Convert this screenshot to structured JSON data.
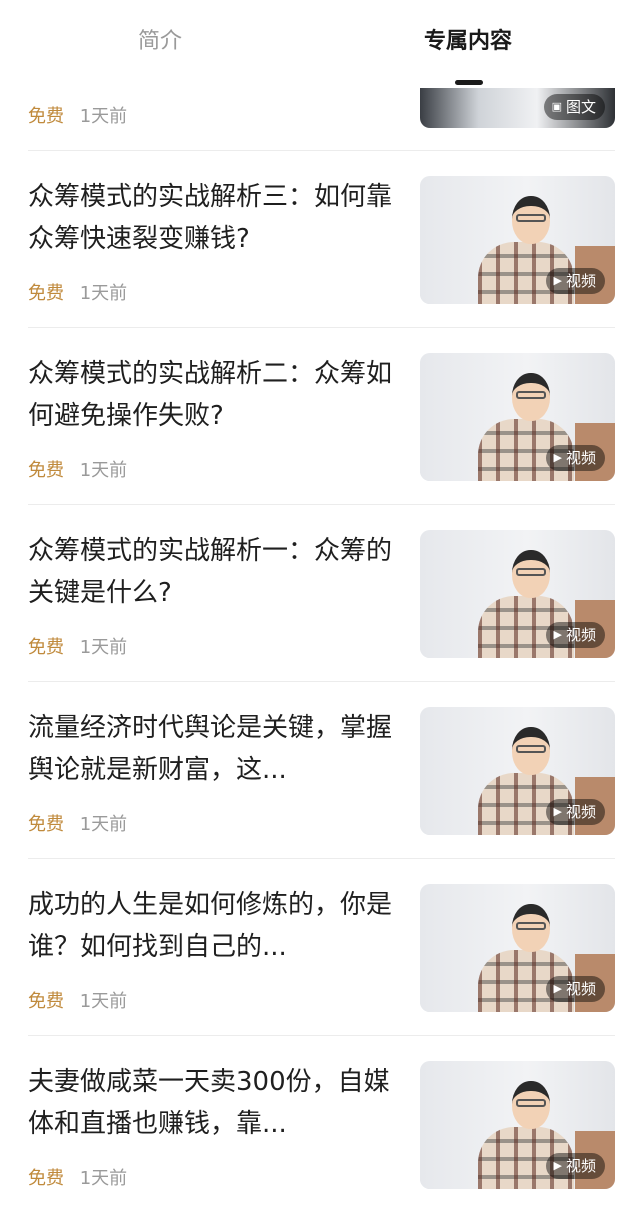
{
  "tabs": [
    {
      "label": "简介",
      "active": false
    },
    {
      "label": "专属内容",
      "active": true
    }
  ],
  "colors": {
    "accent_free": "#c08a3c",
    "muted": "#9a9a9a",
    "active_tab": "#1a1a1a"
  },
  "partial_item": {
    "free": "免费",
    "time": "1天前",
    "badge": "图文",
    "badge_icon": "image-icon"
  },
  "items": [
    {
      "title": "众筹模式的实战解析三：如何靠众筹快速裂变赚钱?",
      "free": "免费",
      "time": "1天前",
      "badge": "视频",
      "badge_icon": "play-icon"
    },
    {
      "title": "众筹模式的实战解析二：众筹如何避免操作失败?",
      "free": "免费",
      "time": "1天前",
      "badge": "视频",
      "badge_icon": "play-icon"
    },
    {
      "title": "众筹模式的实战解析一：众筹的关键是什么?",
      "free": "免费",
      "time": "1天前",
      "badge": "视频",
      "badge_icon": "play-icon"
    },
    {
      "title": "流量经济时代舆论是关键，掌握舆论就是新财富，这...",
      "free": "免费",
      "time": "1天前",
      "badge": "视频",
      "badge_icon": "play-icon"
    },
    {
      "title": "成功的人生是如何修炼的，你是谁？如何找到自己的...",
      "free": "免费",
      "time": "1天前",
      "badge": "视频",
      "badge_icon": "play-icon"
    },
    {
      "title": "夫妻做咸菜一天卖300份，自媒体和直播也赚钱，靠...",
      "free": "免费",
      "time": "1天前",
      "badge": "视频",
      "badge_icon": "play-icon"
    }
  ]
}
